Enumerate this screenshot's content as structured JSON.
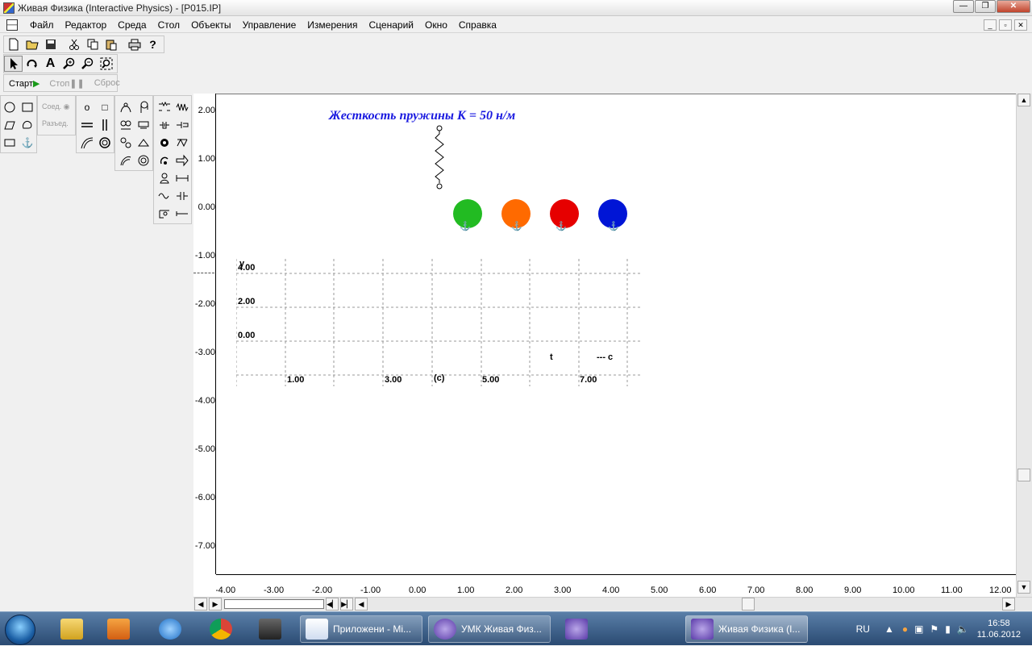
{
  "window": {
    "title": "Живая Физика (Interactive Physics) - [P015.IP]",
    "buttons": [
      "minimize-icon",
      "restore-icon",
      "close-icon"
    ]
  },
  "menu": {
    "items": [
      "Файл",
      "Редактор",
      "Среда",
      "Стол",
      "Объекты",
      "Управление",
      "Измерения",
      "Сценарий",
      "Окно",
      "Справка"
    ],
    "mdi_buttons": [
      "_",
      "▫",
      "✕"
    ]
  },
  "toolbar": {
    "file_icons": [
      "new-icon",
      "open-icon",
      "save-icon",
      "cut-icon",
      "copy-icon",
      "paste-icon",
      "print-icon",
      "help-icon"
    ],
    "tool_icons": [
      "arrow-icon",
      "rotate-icon",
      "text-icon",
      "zoom-in-icon",
      "zoom-out-icon",
      "zoom-fit-icon"
    ]
  },
  "run": {
    "start": "Старт",
    "stop": "Стоп",
    "reset": "Сброс"
  },
  "palette": {
    "join": "Соед.",
    "split": "Разъед."
  },
  "simulation": {
    "title": "Жесткость пружины К = 50 н/м",
    "ball_colors": [
      "#22bb22",
      "#ff6a00",
      "#e60000",
      "#0015d6"
    ]
  },
  "rulers": {
    "y_ticks": [
      "2.00",
      "1.00",
      "0.00",
      "-1.00",
      "-2.00",
      "-3.00",
      "-4.00",
      "-5.00",
      "-6.00",
      "-7.00"
    ],
    "x_ticks": [
      "-4.00",
      "-3.00",
      "-2.00",
      "-1.00",
      "0.00",
      "1.00",
      "2.00",
      "3.00",
      "4.00",
      "5.00",
      "6.00",
      "7.00",
      "8.00",
      "9.00",
      "10.00",
      "11.00",
      "12.00"
    ]
  },
  "graph": {
    "y_label": "y",
    "y_ticks": [
      "4.00",
      "2.00",
      "0.00"
    ],
    "t_label": "t",
    "t_unit": "--- c",
    "x_ticks": [
      "1.00",
      "3.00",
      "5.00",
      "7.00"
    ],
    "x_unit": "(c)"
  },
  "taskbar": {
    "pinned": [
      "explorer-icon",
      "media-player-icon",
      "ie-icon",
      "chrome-icon",
      "app-icon"
    ],
    "windows": [
      "Приложени - Mi...",
      "УМК Живая Физ...",
      "",
      "Живая Физика (I..."
    ],
    "lang": "RU",
    "time": "16:58",
    "date": "11.06.2012"
  }
}
